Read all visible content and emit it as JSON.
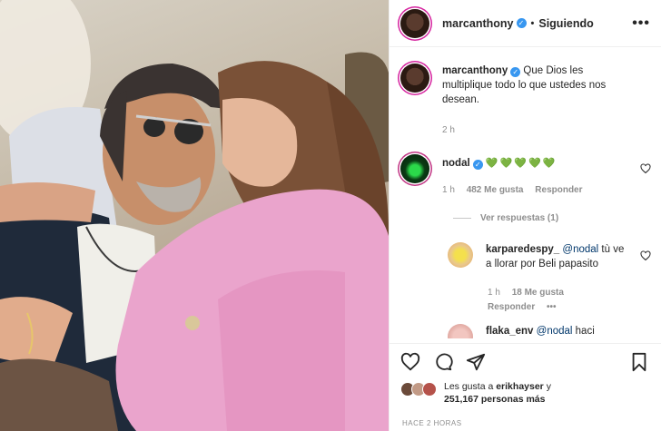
{
  "header": {
    "username": "marcanthony",
    "separator": "•",
    "follow_status": "Siguiendo",
    "more_label": "•••"
  },
  "caption": {
    "username": "marcanthony",
    "text": "Que Dios les multiplique todo lo que ustedes nos desean.",
    "time": "2 h"
  },
  "comments": [
    {
      "username": "nodal",
      "text": "💚💚💚💚💚",
      "time": "1 h",
      "likes": "482 Me gusta",
      "reply": "Responder",
      "view_replies": "Ver respuestas (1)"
    },
    {
      "username": "karparedespy_",
      "mention": "@nodal",
      "text": "tù ve a llorar por Beli papasito",
      "time": "1 h",
      "likes": "18 Me gusta",
      "reply": "Responder",
      "more": "•••"
    },
    {
      "username": "flaka_env",
      "mention": "@nodal",
      "text": "haci"
    }
  ],
  "likes": {
    "line1_prefix": "Les gusta a",
    "line1_user": "erikhayser",
    "line1_suffix": "y",
    "line2_count": "251,167 personas más"
  },
  "timestamp": "HACE 2 HORAS",
  "icons": {
    "heart": "heart-icon",
    "comment": "comment-icon",
    "share": "share-icon",
    "save": "bookmark-icon",
    "verified": "verified-badge-icon"
  },
  "colors": {
    "verified": "#3897f0",
    "mention": "#00376b",
    "secondary_text": "#8e8e8e",
    "hearts": "#2ecc4f"
  }
}
